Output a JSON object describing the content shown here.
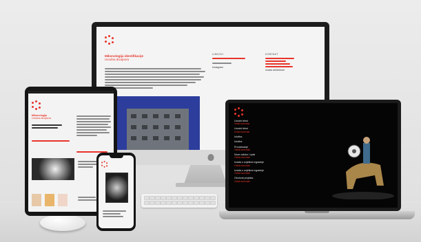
{
  "colors": {
    "accent": "#e8332a",
    "background": "#e6e6e6",
    "device_dark": "#1b1b1b",
    "building_sky": "#2c3d9c"
  },
  "desktop": {
    "heading_line1": "Mikonologija identifikacije",
    "heading_line2": "Uvodna dizajnera",
    "column_links_label": "LINKOVI",
    "column_contact_label": "KONTAKT",
    "col2_item": "Instagram",
    "col3_item": "Izrada arhitekture"
  },
  "laptop": {
    "menu_items": [
      {
        "title": "Uvodni tekst",
        "sub": "Kratki komentar"
      },
      {
        "title": "Uvodni tekst",
        "sub": "Kratki komentar"
      },
      {
        "title": "Izložba",
        "sub": ""
      },
      {
        "title": "Izložba",
        "sub": ""
      },
      {
        "title": "Proučavanje",
        "sub": "Ostali komentari"
      },
      {
        "title": "Nove odluke i opisi",
        "sub": "Ostali komentari"
      },
      {
        "title": "Izrada o uvjetima izgradnje",
        "sub": "Ostali komentari"
      },
      {
        "title": "Izrada o uvjetima izgradnje",
        "sub": "Ostali komentari"
      },
      {
        "title": "Obuhvat projekta",
        "sub": "Ostali komentari"
      }
    ]
  },
  "tablet": {
    "title": "Mikonologija",
    "subtitle": "Uvodna dizajnera"
  },
  "icons": [
    "studio-logo-icon",
    "apple-logo-icon"
  ]
}
